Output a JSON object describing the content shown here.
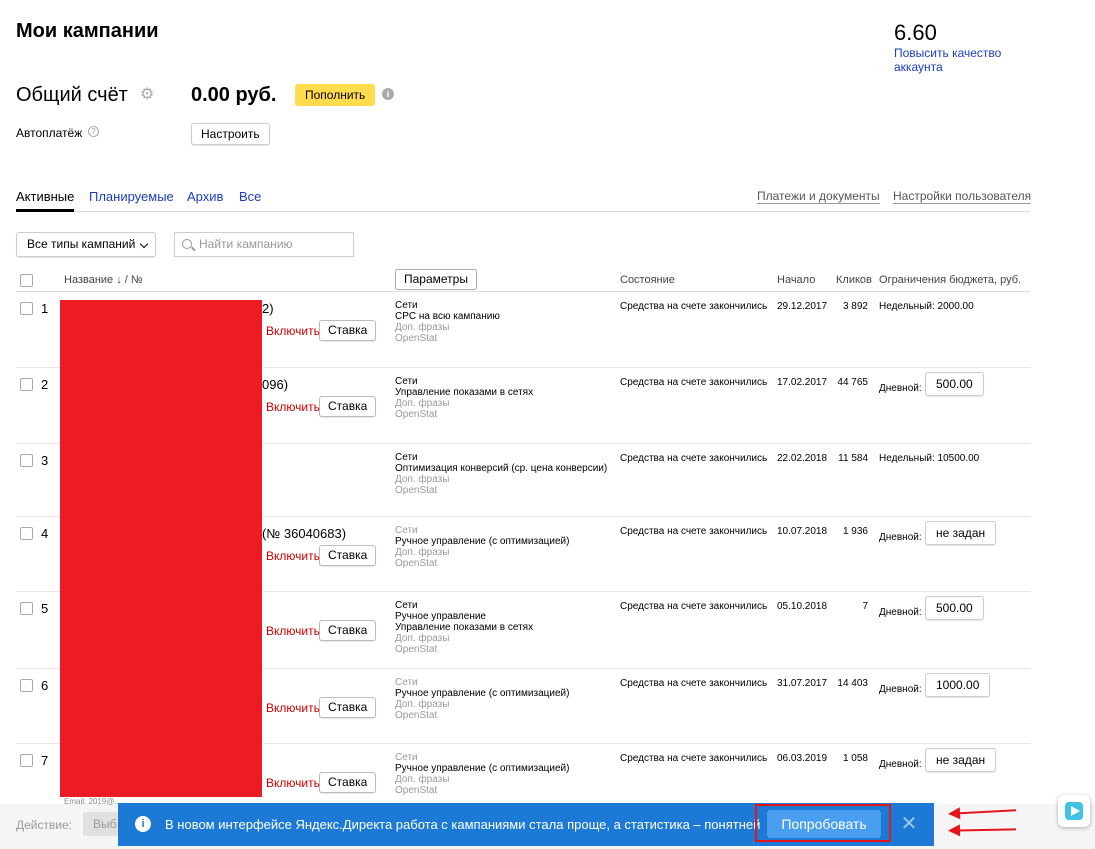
{
  "header": {
    "title": "Мои кампании",
    "quality_score": "6.60",
    "quality_link": "Повысить качество аккаунта"
  },
  "account": {
    "label": "Общий счёт",
    "balance": "0.00 руб.",
    "topup_label": "Пополнить",
    "autopay_label": "Автоплатёж",
    "setup_label": "Настроить"
  },
  "tabs": [
    {
      "label": "Активные",
      "active": true
    },
    {
      "label": "Планируемые",
      "active": false
    },
    {
      "label": "Архив",
      "active": false
    },
    {
      "label": "Все",
      "active": false
    }
  ],
  "tab_links": {
    "payments": "Платежи и документы",
    "settings": "Настройки пользователя"
  },
  "filters": {
    "type_select": "Все типы кампаний",
    "search_placeholder": "Найти кампанию"
  },
  "columns": {
    "name": "Название ↓ / №",
    "params": "Параметры",
    "state": "Состояние",
    "start": "Начало",
    "clicks": "Кликов",
    "limits": "Ограничения бюджета, руб."
  },
  "rows": [
    {
      "num": "1",
      "name_frag": "2)",
      "enable": "Включить",
      "bid": "Ставка",
      "params": [
        "Сети",
        "CPC на всю кампанию"
      ],
      "params_gray": [
        "Доп. фразы",
        "OpenStat"
      ],
      "state": "Средства на счете закончились",
      "start": "29.12.2017",
      "clicks": "3 892",
      "limit_text": "Недельный: 2000.00",
      "limit_value": ""
    },
    {
      "num": "2",
      "name_frag": "096)",
      "enable": "Включить",
      "bid": "Ставка",
      "params": [
        "Сети",
        "Управление показами в сетях"
      ],
      "params_gray": [
        "Доп. фразы",
        "OpenStat"
      ],
      "state": "Средства на счете закончились",
      "start": "17.02.2017",
      "clicks": "44 765",
      "limit_text": "Дневной:",
      "limit_value": "500.00"
    },
    {
      "num": "3",
      "name_frag": "",
      "enable": "",
      "bid": "",
      "params": [
        "Сети",
        "Оптимизация конверсий (ср. цена конверсии)"
      ],
      "params_gray": [
        "Доп. фразы",
        "OpenStat"
      ],
      "state": "Средства на счете закончились",
      "start": "22.02.2018",
      "clicks": "11 584",
      "limit_text": "Недельный: 10500.00",
      "limit_value": ""
    },
    {
      "num": "4",
      "name_frag": "(№ 36040683)",
      "enable": "Включить",
      "bid": "Ставка",
      "params_gray_top": [
        "Сети"
      ],
      "params": [
        "Ручное управление (с оптимизацией)"
      ],
      "params_gray": [
        "Доп. фразы",
        "OpenStat"
      ],
      "state": "Средства на счете закончились",
      "start": "10.07.2018",
      "clicks": "1 936",
      "limit_text": "Дневной:",
      "limit_value": "не задан"
    },
    {
      "num": "5",
      "name_frag": "",
      "enable": "Включить",
      "bid": "Ставка",
      "params": [
        "Сети",
        "Ручное управление",
        "Управление показами в сетях"
      ],
      "params_gray": [
        "Доп. фразы",
        "OpenStat"
      ],
      "state": "Средства на счете закончились",
      "start": "05.10.2018",
      "clicks": "7",
      "limit_text": "Дневной:",
      "limit_value": "500.00"
    },
    {
      "num": "6",
      "name_frag": "",
      "enable": "Включить",
      "bid": "Ставка",
      "params_gray_top": [
        "Сети"
      ],
      "params": [
        "Ручное управление (с оптимизацией)"
      ],
      "params_gray": [
        "Доп. фразы",
        "OpenStat"
      ],
      "state": "Средства на счете закончились",
      "start": "31.07.2017",
      "clicks": "14 403",
      "limit_text": "Дневной:",
      "limit_value": "1000.00"
    },
    {
      "num": "7",
      "name_frag": "",
      "enable": "Включить",
      "bid": "Ставка",
      "params_gray_top": [
        "Сети"
      ],
      "params": [
        "Ручное управление (с оптимизацией)"
      ],
      "params_gray": [
        "Доп. фразы",
        "OpenStat"
      ],
      "state": "Средства на счете закончились",
      "start": "06.03.2019",
      "clicks": "1 058",
      "limit_text": "Дневной:",
      "limit_value": "не задан"
    }
  ],
  "bottom": {
    "action_label": "Действие:",
    "action_btn": "Выб",
    "email_frag": "Email:                  2019@..."
  },
  "banner": {
    "text": "В новом интерфейсе Яндекс.Директа работа с кампаниями стала проще, а статистика – понятней",
    "try_label": "Попробовать"
  },
  "colors": {
    "link": "#1a3dc1",
    "accent_yellow": "#ffdb4d",
    "banner_blue": "#1c7ad6",
    "highlight_red": "#e4141b"
  }
}
